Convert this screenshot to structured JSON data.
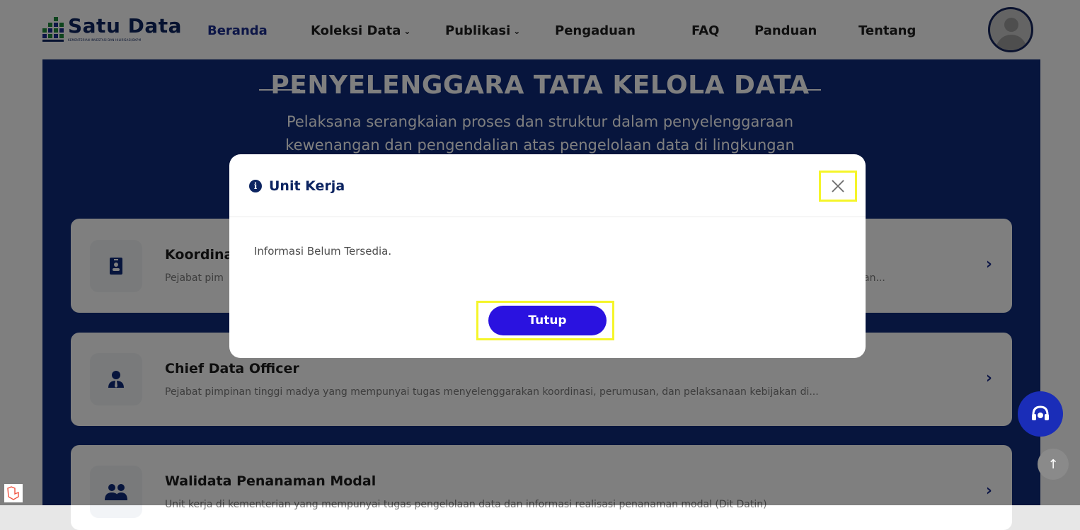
{
  "nav": {
    "logo_title": "Satu Data",
    "logo_subtitle": "KEMENTERIAN INVESTASI DAN HILIRISASI/BKPM",
    "items": [
      {
        "label": "Beranda",
        "active": true,
        "dropdown": false
      },
      {
        "label": "Koleksi Data",
        "active": false,
        "dropdown": true
      },
      {
        "label": "Publikasi",
        "active": false,
        "dropdown": true
      },
      {
        "label": "Pengaduan",
        "active": false,
        "dropdown": false
      },
      {
        "label": "FAQ",
        "active": false,
        "dropdown": false
      },
      {
        "label": "Panduan",
        "active": false,
        "dropdown": false
      },
      {
        "label": "Tentang",
        "active": false,
        "dropdown": false
      }
    ],
    "avatar_icon": "user-avatar-icon"
  },
  "hero": {
    "title": "PENYELENGGARA TATA KELOLA DATA",
    "description": "Pelaksana serangkaian proses dan struktur dalam penyelenggaraan kewenangan dan pengendalian atas pengelolaan data di lingkungan"
  },
  "cards": [
    {
      "title": "Koordina",
      "desc": "Pejabat pim",
      "desc_tail": "an...",
      "icon": "id-badge-icon"
    },
    {
      "title": "Chief Data Officer",
      "desc": "Pejabat pimpinan tinggi madya yang mempunyai tugas menyelenggarakan koordinasi, perumusan, dan pelaksanaan kebijakan di...",
      "icon": "user-tie-icon"
    },
    {
      "title": "Walidata Penanaman Modal",
      "desc": "Unit kerja di kementerian yang mempunyai tugas pengelolaan data dan informasi realisasi penanaman modal (Dit Datin)",
      "icon": "users-icon"
    }
  ],
  "modal": {
    "title": "Unit Kerja",
    "body": "Informasi Belum Tersedia.",
    "button_label": "Tutup",
    "close_glyph": "×"
  },
  "colors": {
    "brand_navy": "#0f2a7a",
    "button_blue": "#2a12e0",
    "highlight_yellow": "#f5f52a"
  }
}
